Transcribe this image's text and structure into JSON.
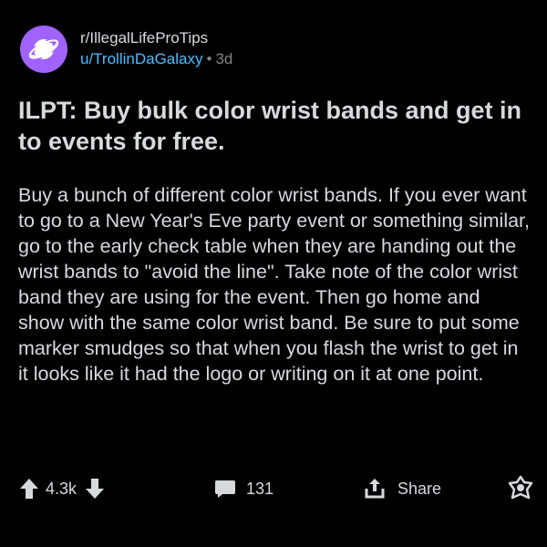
{
  "post": {
    "subreddit": "r/IllegalLifeProTips",
    "username": "u/TrollinDaGalaxy",
    "separator": "•",
    "age": "3d",
    "title": "ILPT: Buy bulk color wrist bands and get in to events for free.",
    "body": "Buy a bunch of different color wrist bands. If you ever want to go to a New Year's Eve party event or something similar, go to the early check table when they are handing out the wrist bands to \"avoid the line\".  Take note of the color wrist band they are using for the event.  Then go home and show with the same color wrist band.  Be sure to put some marker smudges so that when you flash the wrist to get in it looks like it had the logo or writing on it at one point."
  },
  "actions": {
    "score": "4.3k",
    "comments": "131",
    "share_label": "Share"
  },
  "icons": {
    "subreddit": "planet-icon",
    "upvote": "upvote-arrow-icon",
    "downvote": "downvote-arrow-icon",
    "comment": "comment-bubble-icon",
    "share": "share-icon",
    "award": "award-icon"
  },
  "colors": {
    "background": "#000000",
    "text": "#d7dadc",
    "username": "#4fbcff",
    "muted": "#818384",
    "subreddit_icon_bg": "#a163ff"
  }
}
